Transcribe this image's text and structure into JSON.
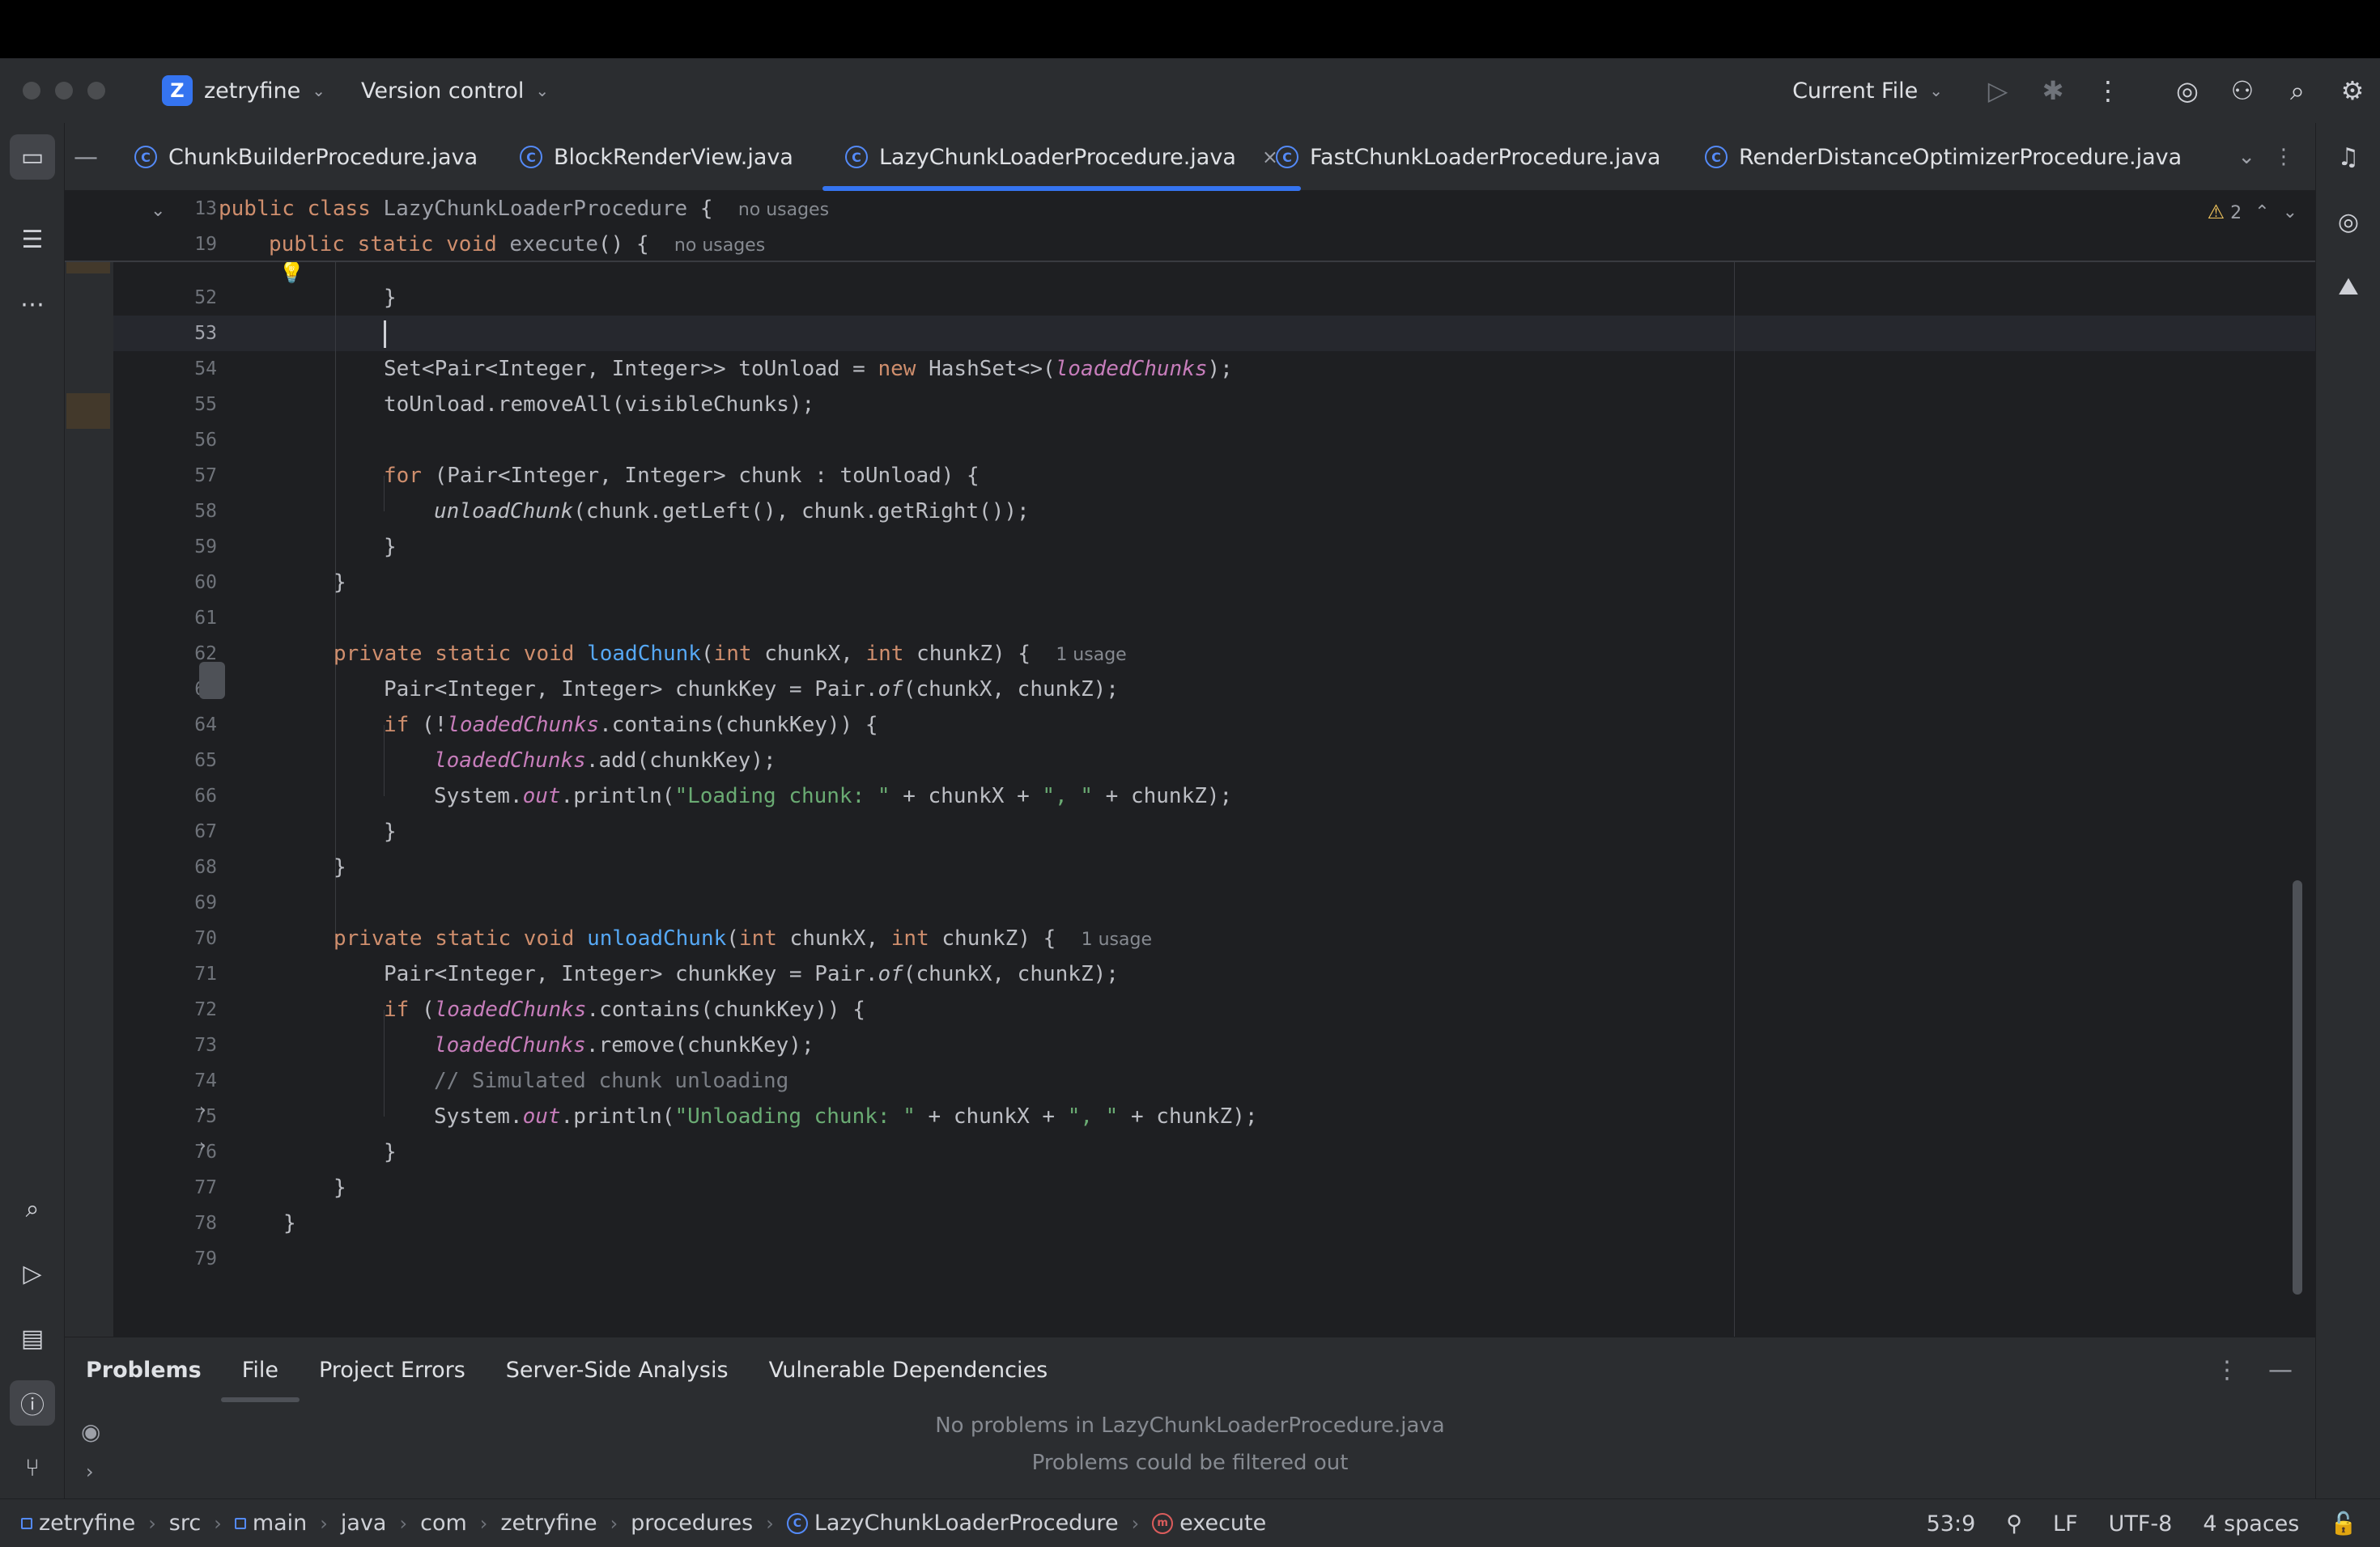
{
  "project": {
    "initial": "Z",
    "name": "zetryfine"
  },
  "version_control": "Version control",
  "run_config": "Current File",
  "tabs": [
    {
      "label": "ChunkBuilderProcedure.java"
    },
    {
      "label": "BlockRenderView.java"
    },
    {
      "label": "LazyChunkLoaderProcedure.java"
    },
    {
      "label": "FastChunkLoaderProcedure.java"
    },
    {
      "label": "RenderDistanceOptimizerProcedure.java"
    }
  ],
  "close_glyph": "×",
  "warnings": {
    "count": "2"
  },
  "sticky": [
    {
      "ln": "13",
      "code": "public class LazyChunkLoaderProcedure {",
      "hint": "no usages"
    },
    {
      "ln": "19",
      "code": "public static void execute() {",
      "hint": "no usages"
    }
  ],
  "lines": [
    {
      "n": "52"
    },
    {
      "n": "53"
    },
    {
      "n": "54"
    },
    {
      "n": "55"
    },
    {
      "n": "56"
    },
    {
      "n": "57"
    },
    {
      "n": "58"
    },
    {
      "n": "59"
    },
    {
      "n": "60"
    },
    {
      "n": "61"
    },
    {
      "n": "62"
    },
    {
      "n": "63"
    },
    {
      "n": "64"
    },
    {
      "n": "65"
    },
    {
      "n": "66"
    },
    {
      "n": "67"
    },
    {
      "n": "68"
    },
    {
      "n": "69"
    },
    {
      "n": "70"
    },
    {
      "n": "71"
    },
    {
      "n": "72"
    },
    {
      "n": "73"
    },
    {
      "n": "74"
    },
    {
      "n": "75"
    },
    {
      "n": "76"
    },
    {
      "n": "77"
    },
    {
      "n": "78"
    },
    {
      "n": "79"
    }
  ],
  "code": {
    "l52": "}",
    "l54_a": "Set<Pair<Integer, Integer>> toUnload = ",
    "l54_kw": "new",
    "l54_b": " HashSet<>(",
    "l54_f": "loadedChunks",
    "l54_c": ");",
    "l55": "toUnload.removeAll(visibleChunks);",
    "l57_kw": "for",
    "l57_a": " (Pair<Integer, Integer> chunk : toUnload) {",
    "l58_fn": "unloadChunk",
    "l58_a": "(chunk.getLeft(), chunk.getRight());",
    "l59": "}",
    "l60": "}",
    "l62_kw": "private static void",
    "l62_fn": "loadChunk",
    "l62_a": "(",
    "l62_kw2": "int",
    "l62_b": " chunkX, ",
    "l62_kw3": "int",
    "l62_c": " chunkZ) {",
    "l62_hint": "1 usage",
    "l63_a": "Pair<Integer, Integer> chunkKey = Pair.",
    "l63_s": "of",
    "l63_b": "(chunkX, chunkZ);",
    "l64_kw": "if",
    "l64_a": " (!",
    "l64_f": "loadedChunks",
    "l64_b": ".contains(chunkKey)) {",
    "l65_f": "loadedChunks",
    "l65_a": ".add(chunkKey);",
    "l66_a": "System.",
    "l66_o": "out",
    "l66_b": ".println(",
    "l66_s1": "\"Loading chunk: \"",
    "l66_c": " + chunkX + ",
    "l66_s2": "\", \"",
    "l66_d": " + chunkZ);",
    "l67": "}",
    "l68": "}",
    "l70_kw": "private static void",
    "l70_fn": "unloadChunk",
    "l70_a": "(",
    "l70_kw2": "int",
    "l70_b": " chunkX, ",
    "l70_kw3": "int",
    "l70_c": " chunkZ) {",
    "l70_hint": "1 usage",
    "l71_a": "Pair<Integer, Integer> chunkKey = Pair.",
    "l71_s": "of",
    "l71_b": "(chunkX, chunkZ);",
    "l72_kw": "if",
    "l72_a": " (",
    "l72_f": "loadedChunks",
    "l72_b": ".contains(chunkKey)) {",
    "l73_f": "loadedChunks",
    "l73_a": ".remove(chunkKey);",
    "l74": "// Simulated chunk unloading",
    "l75_a": "System.",
    "l75_o": "out",
    "l75_b": ".println(",
    "l75_s1": "\"Unloading chunk: \"",
    "l75_c": " + chunkX + ",
    "l75_s2": "\", \"",
    "l75_d": " + chunkZ);",
    "l76": "}",
    "l77": "}",
    "l78": "}"
  },
  "problems": {
    "tabs": [
      "Problems",
      "File",
      "Project Errors",
      "Server-Side Analysis",
      "Vulnerable Dependencies"
    ],
    "message1": "No problems in LazyChunkLoaderProcedure.java",
    "message2": "Problems could be filtered out"
  },
  "breadcrumbs": [
    "zetryfine",
    "src",
    "main",
    "java",
    "com",
    "zetryfine",
    "procedures",
    "LazyChunkLoaderProcedure",
    "execute"
  ],
  "status": {
    "position": "53:9",
    "line_sep": "LF",
    "encoding": "UTF-8",
    "indent": "4 spaces"
  }
}
